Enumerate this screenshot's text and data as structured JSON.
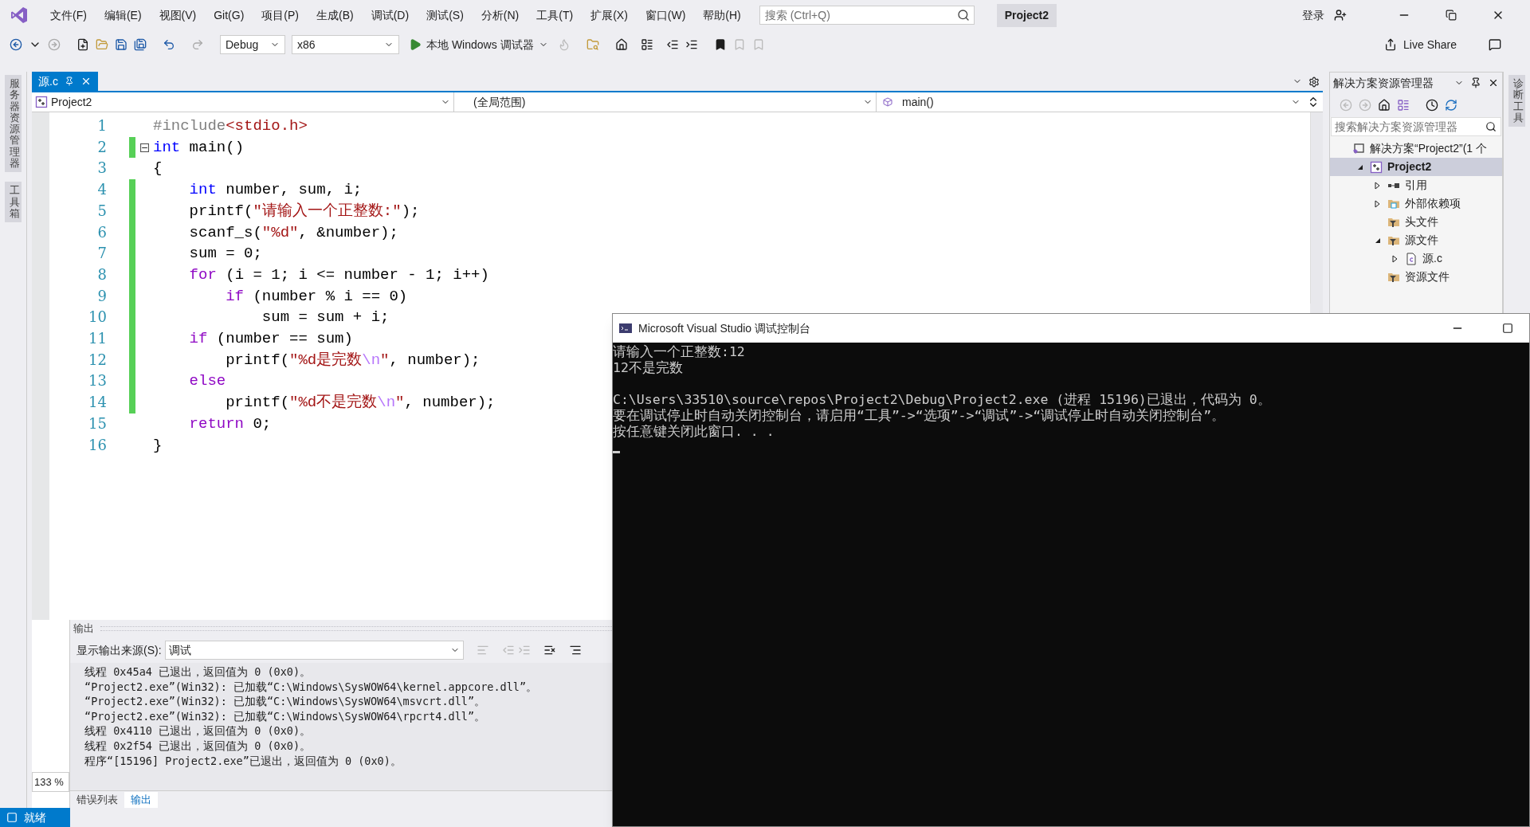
{
  "menu_bar": {
    "items": [
      "文件(F)",
      "编辑(E)",
      "视图(V)",
      "Git(G)",
      "项目(P)",
      "生成(B)",
      "调试(D)",
      "测试(S)",
      "分析(N)",
      "工具(T)",
      "扩展(X)",
      "窗口(W)",
      "帮助(H)"
    ],
    "search_placeholder": "搜索 (Ctrl+Q)",
    "project_title": "Project2",
    "sign_in": "登录"
  },
  "toolbar": {
    "configuration": "Debug",
    "platform": "x86",
    "run_label": "本地 Windows 调试器",
    "live_share": "Live Share"
  },
  "left_rail": [
    "服务器资源管理器",
    "工具箱"
  ],
  "right_rail": [
    "诊断工具"
  ],
  "editor": {
    "tabs": [
      {
        "label": "源.c",
        "selected": true
      }
    ],
    "nav": {
      "project": "Project2",
      "scope": "(全局范围)",
      "member": "main()"
    },
    "lines": [
      {
        "number": "1",
        "modified": false,
        "tokens": [
          {
            "kind": "preprocessor",
            "text": "#include"
          },
          {
            "kind": "header",
            "text": "<stdio.h>"
          }
        ]
      },
      {
        "number": "2",
        "modified": true,
        "fold": true,
        "tokens": [
          {
            "kind": "keyword",
            "text": "int"
          },
          {
            "kind": "plain",
            "text": " main()"
          }
        ]
      },
      {
        "number": "3",
        "modified": false,
        "tokens": [
          {
            "kind": "plain",
            "text": "{"
          }
        ]
      },
      {
        "number": "4",
        "modified": true,
        "tokens": [
          {
            "kind": "keyword",
            "text": "    int"
          },
          {
            "kind": "plain",
            "text": " number, sum, i;"
          }
        ]
      },
      {
        "number": "5",
        "modified": true,
        "tokens": [
          {
            "kind": "plain",
            "text": "    printf("
          },
          {
            "kind": "string",
            "text": "\"请输入一个正整数:\""
          },
          {
            "kind": "plain",
            "text": ");"
          }
        ]
      },
      {
        "number": "6",
        "modified": true,
        "tokens": [
          {
            "kind": "plain",
            "text": "    scanf_s("
          },
          {
            "kind": "string",
            "text": "\"%d\""
          },
          {
            "kind": "plain",
            "text": ", &number);"
          }
        ]
      },
      {
        "number": "7",
        "modified": true,
        "tokens": [
          {
            "kind": "plain",
            "text": "    sum = 0;"
          }
        ]
      },
      {
        "number": "8",
        "modified": true,
        "tokens": [
          {
            "kind": "control",
            "text": "    for"
          },
          {
            "kind": "plain",
            "text": " (i = 1; i <= number - 1; i++)"
          }
        ]
      },
      {
        "number": "9",
        "modified": true,
        "tokens": [
          {
            "kind": "control",
            "text": "        if"
          },
          {
            "kind": "plain",
            "text": " (number % i == 0)"
          }
        ]
      },
      {
        "number": "10",
        "modified": true,
        "tokens": [
          {
            "kind": "plain",
            "text": "            sum = sum + i;"
          }
        ]
      },
      {
        "number": "11",
        "modified": true,
        "tokens": [
          {
            "kind": "control",
            "text": "    if"
          },
          {
            "kind": "plain",
            "text": " (number == sum)"
          }
        ]
      },
      {
        "number": "12",
        "modified": true,
        "tokens": [
          {
            "kind": "plain",
            "text": "        printf("
          },
          {
            "kind": "string",
            "text": "\"%d是完数"
          },
          {
            "kind": "escape",
            "text": "\\n"
          },
          {
            "kind": "string",
            "text": "\""
          },
          {
            "kind": "plain",
            "text": ", number);"
          }
        ]
      },
      {
        "number": "13",
        "modified": true,
        "tokens": [
          {
            "kind": "control",
            "text": "    else"
          }
        ]
      },
      {
        "number": "14",
        "modified": true,
        "tokens": [
          {
            "kind": "plain",
            "text": "        printf("
          },
          {
            "kind": "string",
            "text": "\"%d不是完数"
          },
          {
            "kind": "escape",
            "text": "\\n"
          },
          {
            "kind": "string",
            "text": "\""
          },
          {
            "kind": "plain",
            "text": ", number);"
          }
        ]
      },
      {
        "number": "15",
        "modified": false,
        "tokens": [
          {
            "kind": "control",
            "text": "    return"
          },
          {
            "kind": "plain",
            "text": " 0;"
          }
        ]
      },
      {
        "number": "16",
        "modified": false,
        "tokens": [
          {
            "kind": "plain",
            "text": "}"
          }
        ]
      }
    ],
    "zoom": "133 %"
  },
  "solution_explorer": {
    "title": "解决方案资源管理器",
    "search_placeholder": "搜索解决方案资源管理器",
    "tree": [
      {
        "label": "解决方案“Project2”(1 个",
        "kind": "solution",
        "selected": false,
        "children": [
          {
            "label": "Project2",
            "kind": "project",
            "selected": true,
            "expanded": true,
            "children": [
              {
                "label": "引用",
                "kind": "references",
                "selected": false,
                "expanded": false
              },
              {
                "label": "外部依赖项",
                "kind": "dependencies",
                "selected": false,
                "expanded": false
              },
              {
                "label": "头文件",
                "kind": "filter",
                "selected": false
              },
              {
                "label": "源文件",
                "kind": "filter",
                "selected": false,
                "expanded": true,
                "children": [
                  {
                    "label": "源.c",
                    "kind": "file",
                    "selected": false,
                    "expanded": false
                  }
                ]
              },
              {
                "label": "资源文件",
                "kind": "filter",
                "selected": false
              }
            ]
          }
        ]
      }
    ]
  },
  "output": {
    "title": "输出",
    "source_label": "显示输出来源(S):",
    "source": "调试",
    "lines": [
      "线程 0x45a4 已退出，返回值为 0 (0x0)。",
      "“Project2.exe”(Win32): 已加载“C:\\Windows\\SysWOW64\\kernel.appcore.dll”。",
      "“Project2.exe”(Win32): 已加载“C:\\Windows\\SysWOW64\\msvcrt.dll”。",
      "“Project2.exe”(Win32): 已加载“C:\\Windows\\SysWOW64\\rpcrt4.dll”。",
      "线程 0x4110 已退出，返回值为 0 (0x0)。",
      "线程 0x2f54 已退出，返回值为 0 (0x0)。",
      "程序“[15196] Project2.exe”已退出，返回值为 0 (0x0)。"
    ],
    "tabs": [
      {
        "label": "错误列表",
        "selected": false
      },
      {
        "label": "输出",
        "selected": true
      }
    ]
  },
  "status_bar": {
    "text": "就绪"
  },
  "console": {
    "title": "Microsoft Visual Studio 调试控制台",
    "session": [
      "请输入一个正整数:12",
      "12不是完数"
    ],
    "exit_message": [
      "C:\\Users\\33510\\source\\repos\\Project2\\Debug\\Project2.exe (进程 15196)已退出，代码为 0。",
      "要在调试停止时自动关闭控制台，请启用“工具”->“选项”->“调试”->“调试停止时自动关闭控制台”。",
      "按任意键关闭此窗口. . ."
    ]
  }
}
